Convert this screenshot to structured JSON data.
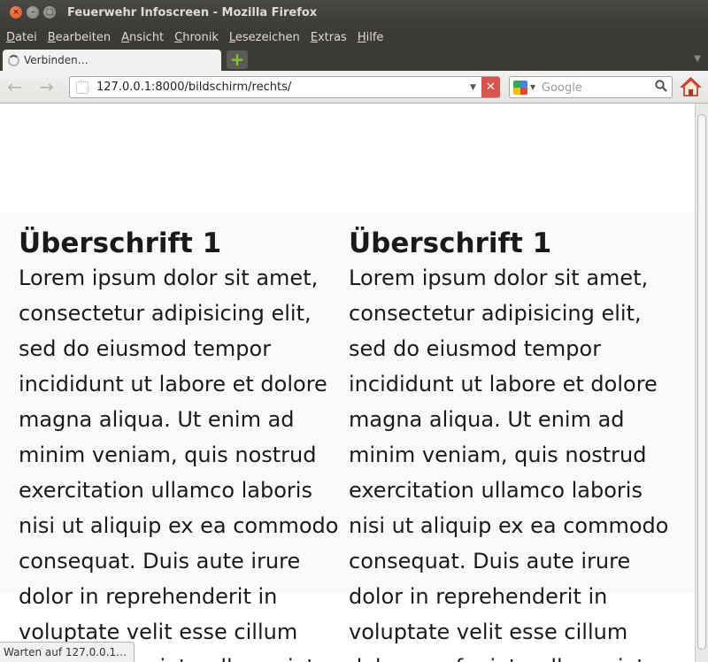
{
  "window": {
    "title": "Feuerwehr Infoscreen - Mozilla Firefox",
    "buttons": {
      "close": "×",
      "minimize": "–",
      "maximize": "□"
    }
  },
  "menu": {
    "items": [
      {
        "accel": "D",
        "rest": "atei"
      },
      {
        "accel": "B",
        "rest": "earbeiten"
      },
      {
        "accel": "A",
        "rest": "nsicht"
      },
      {
        "accel": "C",
        "rest": "hronik"
      },
      {
        "accel": "L",
        "rest": "esezeichen"
      },
      {
        "accel": "E",
        "rest": "xtras"
      },
      {
        "accel": "H",
        "rest": "ilfe"
      }
    ]
  },
  "tabs": {
    "active_label": "Verbinden…",
    "new_tab_symbol": "+"
  },
  "navbar": {
    "back_icon": "←",
    "forward_icon": "→",
    "url": "127.0.0.1:8000/bildschirm/rechts/",
    "stop_icon": "✕",
    "search_engine_icon": "google-icon",
    "search_placeholder": "Google",
    "search_icon": "⚲"
  },
  "content": {
    "columns": [
      {
        "heading": "Überschrift 1",
        "body": "Lorem ipsum dolor sit amet, consectetur adipisicing elit, sed do eiusmod tempor incididunt ut labore et dolore magna aliqua. Ut enim ad minim veniam, quis nostrud exercitation ullamco laboris nisi ut aliquip ex ea commodo consequat. Duis aute irure dolor in reprehenderit in voluptate velit esse cillum dolore eu fugiat nulla pariatur."
      },
      {
        "heading": "Überschrift 1",
        "body": "Lorem ipsum dolor sit amet, consectetur adipisicing elit, sed do eiusmod tempor incididunt ut labore et dolore magna aliqua. Ut enim ad minim veniam, quis nostrud exercitation ullamco laboris nisi ut aliquip ex ea commodo consequat. Duis aute irure dolor in reprehenderit in voluptate velit esse cillum dolore eu fugiat nulla pariatur."
      }
    ]
  },
  "status": {
    "text": "Warten auf 127.0.0.1…"
  },
  "colors": {
    "chrome_dark": "#3c3b37",
    "close_button": "#df4a16",
    "new_tab_plus": "#7ec72a",
    "stop_button": "#d9534f"
  }
}
